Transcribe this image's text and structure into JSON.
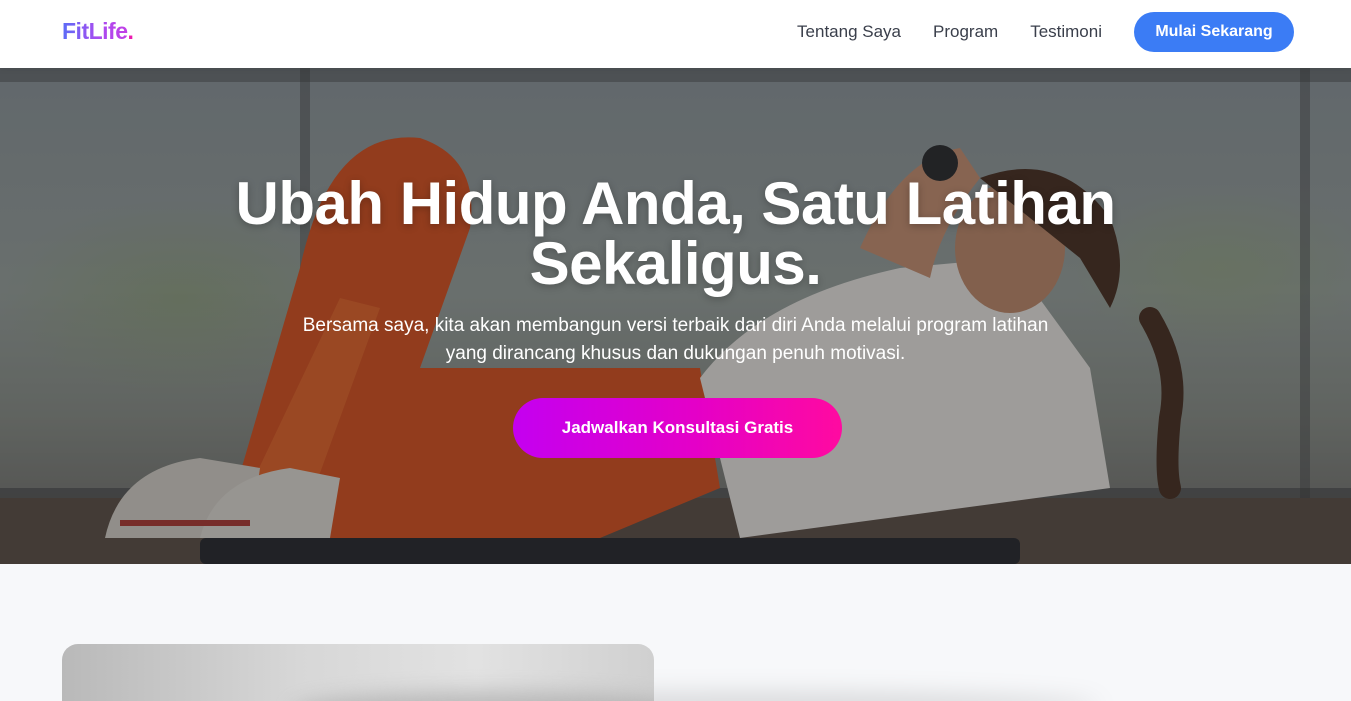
{
  "brand": {
    "logo_text": "FitLife",
    "logo_dot": ".",
    "colors": {
      "primary": "#3b7cf5",
      "accent_from": "#c400f0",
      "accent_to": "#ff0aa0",
      "logo_dot": "#ec1bb0"
    }
  },
  "nav": {
    "links": [
      {
        "label": "Tentang Saya"
      },
      {
        "label": "Program"
      },
      {
        "label": "Testimoni"
      }
    ],
    "cta_label": "Mulai Sekarang"
  },
  "hero": {
    "title": "Ubah Hidup Anda, Satu Latihan Sekaligus.",
    "subtitle": "Bersama saya, kita akan membangun versi terbaik dari diri Anda melalui program latihan yang dirancang khusus dan dukungan penuh motivasi.",
    "cta_label": "Jadwalkan Konsultasi Gratis"
  }
}
